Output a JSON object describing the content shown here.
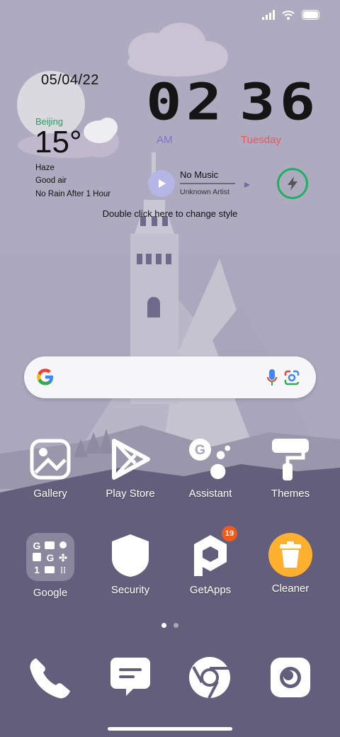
{
  "status_bar": {
    "icons": [
      "signal-icon",
      "wifi-icon",
      "battery-icon"
    ]
  },
  "clock_widget": {
    "date": "05/04/22",
    "hour": "02",
    "minute": "36",
    "ampm": "AM",
    "day": "Tuesday"
  },
  "weather_widget": {
    "city": "Beijing",
    "temperature": "15°",
    "condition": "Haze",
    "air": "Good air",
    "forecast": "No Rain After 1 Hour"
  },
  "music_widget": {
    "title": "No Music",
    "artist": "Unknown Artist"
  },
  "widget_hint": "Double click here to change style",
  "search_bar": {
    "icons": [
      "google-logo-icon",
      "microphone-icon",
      "google-lens-icon"
    ]
  },
  "apps": [
    {
      "label": "Gallery",
      "icon": "gallery-icon"
    },
    {
      "label": "Play Store",
      "icon": "play-store-icon"
    },
    {
      "label": "Assistant",
      "icon": "assistant-icon"
    },
    {
      "label": "Themes",
      "icon": "themes-icon"
    },
    {
      "label": "Google",
      "icon": "google-folder-icon"
    },
    {
      "label": "Security",
      "icon": "security-icon"
    },
    {
      "label": "GetApps",
      "icon": "getapps-icon",
      "badge": "19"
    },
    {
      "label": "Cleaner",
      "icon": "cleaner-icon"
    }
  ],
  "page_indicator": {
    "pages": 2,
    "current": 1
  },
  "dock": [
    {
      "icon": "phone-icon"
    },
    {
      "icon": "messages-icon"
    },
    {
      "icon": "chrome-icon"
    },
    {
      "icon": "camera-icon"
    }
  ],
  "colors": {
    "accent_green": "#1eb060",
    "day_red": "#e45a5a",
    "ampm_purple": "#7e74c4",
    "badge_orange": "#f05a1a"
  }
}
